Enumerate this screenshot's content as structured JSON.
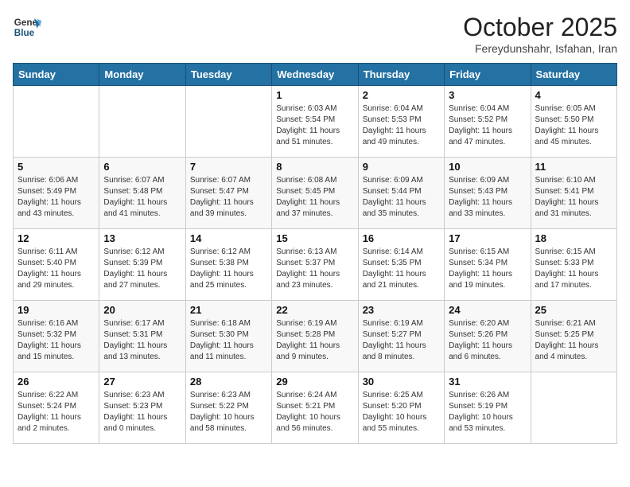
{
  "header": {
    "logo_general": "General",
    "logo_blue": "Blue",
    "month_title": "October 2025",
    "location": "Fereydunshahr, Isfahan, Iran"
  },
  "weekdays": [
    "Sunday",
    "Monday",
    "Tuesday",
    "Wednesday",
    "Thursday",
    "Friday",
    "Saturday"
  ],
  "weeks": [
    [
      null,
      null,
      null,
      {
        "day": "1",
        "sunrise": "Sunrise: 6:03 AM",
        "sunset": "Sunset: 5:54 PM",
        "daylight": "Daylight: 11 hours and 51 minutes."
      },
      {
        "day": "2",
        "sunrise": "Sunrise: 6:04 AM",
        "sunset": "Sunset: 5:53 PM",
        "daylight": "Daylight: 11 hours and 49 minutes."
      },
      {
        "day": "3",
        "sunrise": "Sunrise: 6:04 AM",
        "sunset": "Sunset: 5:52 PM",
        "daylight": "Daylight: 11 hours and 47 minutes."
      },
      {
        "day": "4",
        "sunrise": "Sunrise: 6:05 AM",
        "sunset": "Sunset: 5:50 PM",
        "daylight": "Daylight: 11 hours and 45 minutes."
      }
    ],
    [
      {
        "day": "5",
        "sunrise": "Sunrise: 6:06 AM",
        "sunset": "Sunset: 5:49 PM",
        "daylight": "Daylight: 11 hours and 43 minutes."
      },
      {
        "day": "6",
        "sunrise": "Sunrise: 6:07 AM",
        "sunset": "Sunset: 5:48 PM",
        "daylight": "Daylight: 11 hours and 41 minutes."
      },
      {
        "day": "7",
        "sunrise": "Sunrise: 6:07 AM",
        "sunset": "Sunset: 5:47 PM",
        "daylight": "Daylight: 11 hours and 39 minutes."
      },
      {
        "day": "8",
        "sunrise": "Sunrise: 6:08 AM",
        "sunset": "Sunset: 5:45 PM",
        "daylight": "Daylight: 11 hours and 37 minutes."
      },
      {
        "day": "9",
        "sunrise": "Sunrise: 6:09 AM",
        "sunset": "Sunset: 5:44 PM",
        "daylight": "Daylight: 11 hours and 35 minutes."
      },
      {
        "day": "10",
        "sunrise": "Sunrise: 6:09 AM",
        "sunset": "Sunset: 5:43 PM",
        "daylight": "Daylight: 11 hours and 33 minutes."
      },
      {
        "day": "11",
        "sunrise": "Sunrise: 6:10 AM",
        "sunset": "Sunset: 5:41 PM",
        "daylight": "Daylight: 11 hours and 31 minutes."
      }
    ],
    [
      {
        "day": "12",
        "sunrise": "Sunrise: 6:11 AM",
        "sunset": "Sunset: 5:40 PM",
        "daylight": "Daylight: 11 hours and 29 minutes."
      },
      {
        "day": "13",
        "sunrise": "Sunrise: 6:12 AM",
        "sunset": "Sunset: 5:39 PM",
        "daylight": "Daylight: 11 hours and 27 minutes."
      },
      {
        "day": "14",
        "sunrise": "Sunrise: 6:12 AM",
        "sunset": "Sunset: 5:38 PM",
        "daylight": "Daylight: 11 hours and 25 minutes."
      },
      {
        "day": "15",
        "sunrise": "Sunrise: 6:13 AM",
        "sunset": "Sunset: 5:37 PM",
        "daylight": "Daylight: 11 hours and 23 minutes."
      },
      {
        "day": "16",
        "sunrise": "Sunrise: 6:14 AM",
        "sunset": "Sunset: 5:35 PM",
        "daylight": "Daylight: 11 hours and 21 minutes."
      },
      {
        "day": "17",
        "sunrise": "Sunrise: 6:15 AM",
        "sunset": "Sunset: 5:34 PM",
        "daylight": "Daylight: 11 hours and 19 minutes."
      },
      {
        "day": "18",
        "sunrise": "Sunrise: 6:15 AM",
        "sunset": "Sunset: 5:33 PM",
        "daylight": "Daylight: 11 hours and 17 minutes."
      }
    ],
    [
      {
        "day": "19",
        "sunrise": "Sunrise: 6:16 AM",
        "sunset": "Sunset: 5:32 PM",
        "daylight": "Daylight: 11 hours and 15 minutes."
      },
      {
        "day": "20",
        "sunrise": "Sunrise: 6:17 AM",
        "sunset": "Sunset: 5:31 PM",
        "daylight": "Daylight: 11 hours and 13 minutes."
      },
      {
        "day": "21",
        "sunrise": "Sunrise: 6:18 AM",
        "sunset": "Sunset: 5:30 PM",
        "daylight": "Daylight: 11 hours and 11 minutes."
      },
      {
        "day": "22",
        "sunrise": "Sunrise: 6:19 AM",
        "sunset": "Sunset: 5:28 PM",
        "daylight": "Daylight: 11 hours and 9 minutes."
      },
      {
        "day": "23",
        "sunrise": "Sunrise: 6:19 AM",
        "sunset": "Sunset: 5:27 PM",
        "daylight": "Daylight: 11 hours and 8 minutes."
      },
      {
        "day": "24",
        "sunrise": "Sunrise: 6:20 AM",
        "sunset": "Sunset: 5:26 PM",
        "daylight": "Daylight: 11 hours and 6 minutes."
      },
      {
        "day": "25",
        "sunrise": "Sunrise: 6:21 AM",
        "sunset": "Sunset: 5:25 PM",
        "daylight": "Daylight: 11 hours and 4 minutes."
      }
    ],
    [
      {
        "day": "26",
        "sunrise": "Sunrise: 6:22 AM",
        "sunset": "Sunset: 5:24 PM",
        "daylight": "Daylight: 11 hours and 2 minutes."
      },
      {
        "day": "27",
        "sunrise": "Sunrise: 6:23 AM",
        "sunset": "Sunset: 5:23 PM",
        "daylight": "Daylight: 11 hours and 0 minutes."
      },
      {
        "day": "28",
        "sunrise": "Sunrise: 6:23 AM",
        "sunset": "Sunset: 5:22 PM",
        "daylight": "Daylight: 10 hours and 58 minutes."
      },
      {
        "day": "29",
        "sunrise": "Sunrise: 6:24 AM",
        "sunset": "Sunset: 5:21 PM",
        "daylight": "Daylight: 10 hours and 56 minutes."
      },
      {
        "day": "30",
        "sunrise": "Sunrise: 6:25 AM",
        "sunset": "Sunset: 5:20 PM",
        "daylight": "Daylight: 10 hours and 55 minutes."
      },
      {
        "day": "31",
        "sunrise": "Sunrise: 6:26 AM",
        "sunset": "Sunset: 5:19 PM",
        "daylight": "Daylight: 10 hours and 53 minutes."
      },
      null
    ]
  ]
}
